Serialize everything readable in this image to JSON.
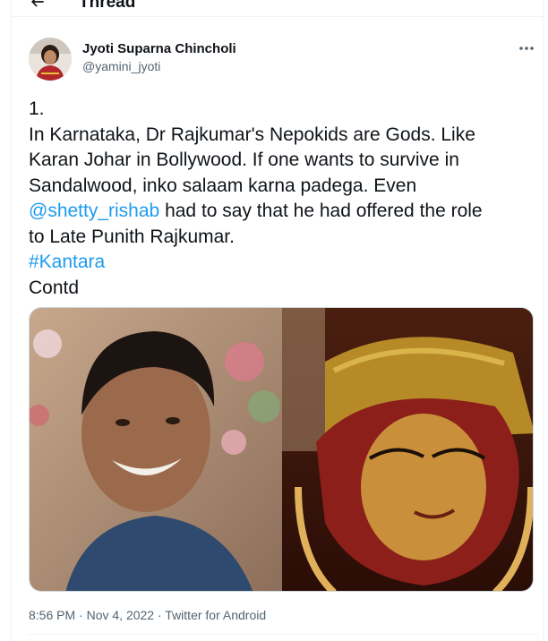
{
  "header": {
    "title": "Thread",
    "back_icon": "arrow-left-icon"
  },
  "tweet": {
    "author_name": "Jyoti Suparna Chincholi",
    "author_handle": "@yamini_jyoti",
    "more_icon": "more-horizontal-icon",
    "text": {
      "line1": "1.",
      "line2": "In Karnataka, Dr Rajkumar's Nepokids are Gods. Like",
      "line3": "Karan Johar in Bollywood. If one wants to survive in",
      "line4": "Sandalwood, inko salaam karna padega. Even",
      "mention": "@shetty_rishab",
      "line5_rest": " had to say that he had offered the role",
      "line6": "to Late Punith Rajkumar.",
      "hashtag": "#Kantara",
      "line8": "Contd"
    },
    "media": {
      "left_image": "smiling-man-photo",
      "right_image": "kantara-character-still"
    },
    "time": "8:56 PM",
    "separator": " · ",
    "date": "Nov 4, 2022",
    "source": "Twitter for Android"
  },
  "colors": {
    "text": "#0f1419",
    "secondary": "#536471",
    "link": "#1d9bf0",
    "divider": "#eff3f4"
  }
}
